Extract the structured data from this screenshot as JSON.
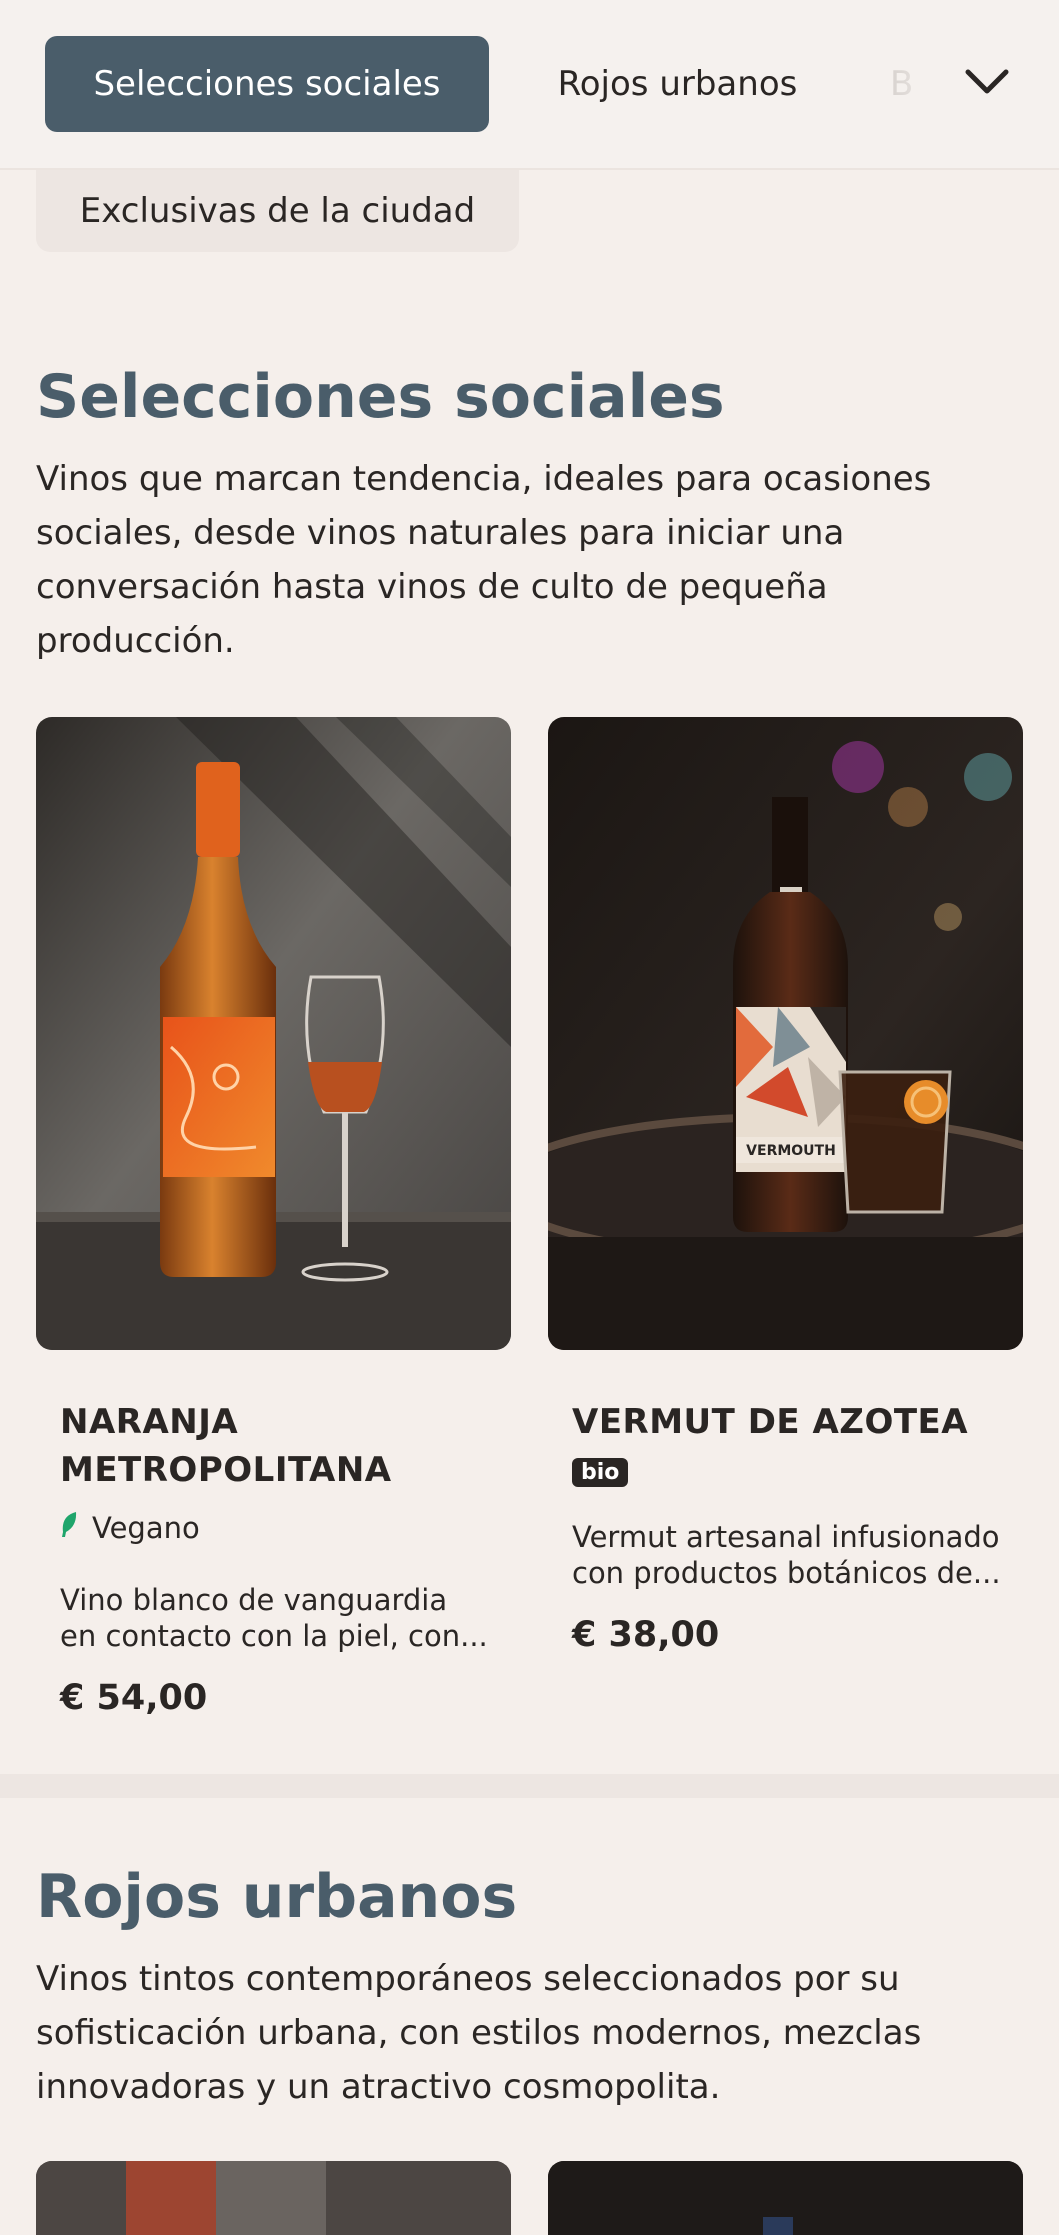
{
  "nav": {
    "tabs": [
      {
        "label": "Selecciones sociales",
        "active": true
      },
      {
        "label": "Rojos urbanos",
        "active": false
      },
      {
        "label": "B",
        "active": false
      },
      {
        "label": "Exclusivas de la ciudad",
        "active": false
      }
    ],
    "expand_icon": "chevron-down-icon"
  },
  "sections": [
    {
      "title": "Selecciones sociales",
      "description": "Vinos que marcan tendencia, ideales para ocasiones sociales, desde vinos naturales para iniciar una conversación hasta vinos de culto de pequeña producción.",
      "products": [
        {
          "name": "NARANJA METROPOLITANA",
          "tag": "Vegano",
          "tag_icon": "leaf-icon",
          "description": "Vino blanco de vanguardia en contacto con la piel, con...",
          "price": "€ 54,00"
        },
        {
          "name": "VERMUT DE AZOTEA",
          "tag": "bio",
          "description": "Vermut artesanal infusionado con productos botánicos de...",
          "price": "€ 38,00",
          "label_text": "VERMOUTH"
        }
      ]
    },
    {
      "title": "Rojos urbanos",
      "description": "Vinos tintos contemporáneos seleccionados por su sofisticación urbana, con estilos modernos, mezclas innovadoras y un atractivo cosmopolita."
    }
  ],
  "colors": {
    "accent": "#4a5d6a",
    "background": "#f5efeb",
    "vegan_leaf": "#1fa56b"
  }
}
